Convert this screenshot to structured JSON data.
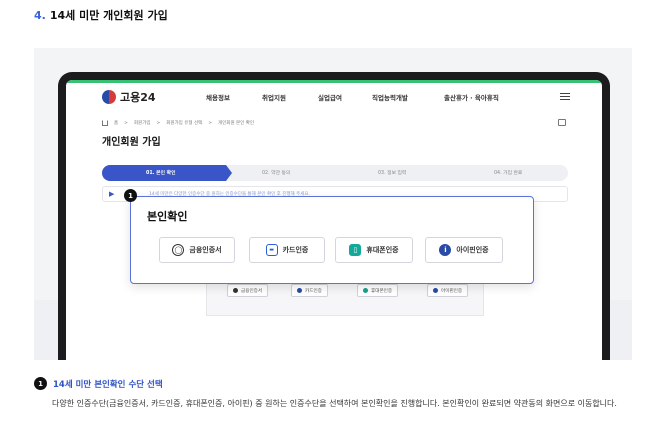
{
  "section": {
    "number": "4.",
    "title": "14세 미만 개인회원 가입"
  },
  "site": {
    "logo": "고용24",
    "nav": [
      "채용정보",
      "취업지원",
      "실업급여",
      "직업능력개발",
      "출산휴가 · 육아휴직"
    ],
    "breadcrumb": [
      "홈",
      ">",
      "회원가입",
      ">",
      "회원가입 유형 선택",
      ">",
      "개인회원 본인 확인"
    ],
    "page_title": "개인회원 가입",
    "steps": [
      "01. 본인 확인",
      "02. 약관 동의",
      "03. 정보 입력",
      "04. 가입 완료"
    ],
    "notice": "14세 미만은 다양한 인증수단 중 원하는 인증수단을 통해 본인 확인 후 진행해 주세요."
  },
  "popup": {
    "badge": "1",
    "title": "본인확인",
    "buttons": [
      {
        "label": "금융인증서",
        "icon": "certificate-icon"
      },
      {
        "label": "카드인증",
        "icon": "card-icon"
      },
      {
        "label": "휴대폰인증",
        "icon": "phone-icon"
      },
      {
        "label": "아이핀인증",
        "icon": "ipin-icon"
      }
    ]
  },
  "caption": {
    "number": "1",
    "title": "14세 미만 본인확인 수단 선택",
    "description": "다양한 인증수단(금융인증서, 카드인증, 휴대폰인증, 아이핀) 중 원하는 인증수단을 선택하여 본인확인을 진행합니다. 본인확인이 완료되면 약관동의 화면으로 이동합니다."
  }
}
